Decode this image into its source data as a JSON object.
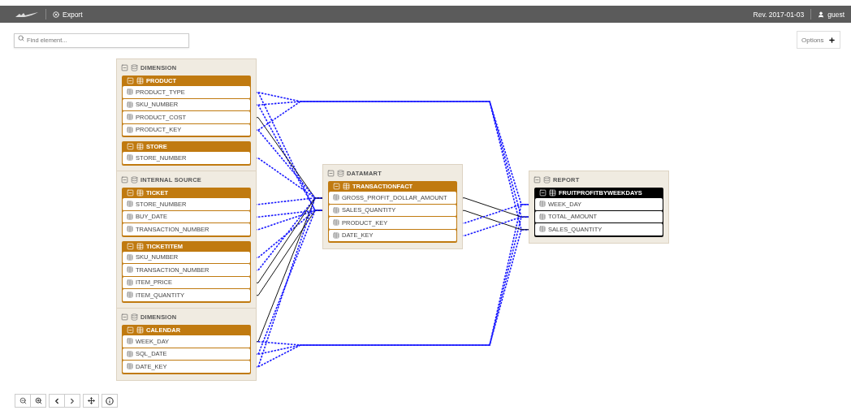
{
  "topbar": {
    "export": "Export",
    "revision": "Rev. 2017-01-03",
    "user": "guest"
  },
  "search": {
    "placeholder": "Find element..."
  },
  "options": {
    "label": "Options"
  },
  "groups": [
    {
      "name": "DIMENSION",
      "expanded": true,
      "tables": [
        {
          "name": "PRODUCT",
          "expanded": true,
          "selected": false,
          "columns": [
            "PRODUCT_TYPE",
            "SKU_NUMBER",
            "PRODUCT_COST",
            "PRODUCT_KEY"
          ]
        },
        {
          "name": "STORE",
          "expanded": true,
          "selected": false,
          "columns": [
            "STORE_NUMBER"
          ]
        }
      ]
    },
    {
      "name": "INTERNAL SOURCE",
      "expanded": true,
      "tables": [
        {
          "name": "TICKET",
          "expanded": true,
          "selected": false,
          "columns": [
            "STORE_NUMBER",
            "BUY_DATE",
            "TRANSACTION_NUMBER"
          ]
        },
        {
          "name": "TICKETITEM",
          "expanded": true,
          "selected": false,
          "columns": [
            "SKU_NUMBER",
            "TRANSACTION_NUMBER",
            "ITEM_PRICE",
            "ITEM_QUANTITY"
          ]
        }
      ]
    },
    {
      "name": "DIMENSION",
      "expanded": true,
      "tables": [
        {
          "name": "CALENDAR",
          "expanded": true,
          "selected": false,
          "columns": [
            "WEEK_DAY",
            "SQL_DATE",
            "DATE_KEY"
          ]
        }
      ]
    },
    {
      "name": "DATAMART",
      "expanded": true,
      "tables": [
        {
          "name": "TRANSACTIONFACT",
          "expanded": true,
          "selected": false,
          "columns": [
            "GROSS_PROFIT_DOLLAR_AMOUNT",
            "SALES_QUANTITY",
            "PRODUCT_KEY",
            "DATE_KEY"
          ]
        }
      ]
    },
    {
      "name": "REPORT",
      "expanded": true,
      "tables": [
        {
          "name": "FRUITPROFITBYWEEKDAYS",
          "expanded": true,
          "selected": true,
          "columns": [
            "WEEK_DAY",
            "TOTAL_AMOUNT",
            "SALES_QUANTITY"
          ]
        }
      ]
    }
  ]
}
